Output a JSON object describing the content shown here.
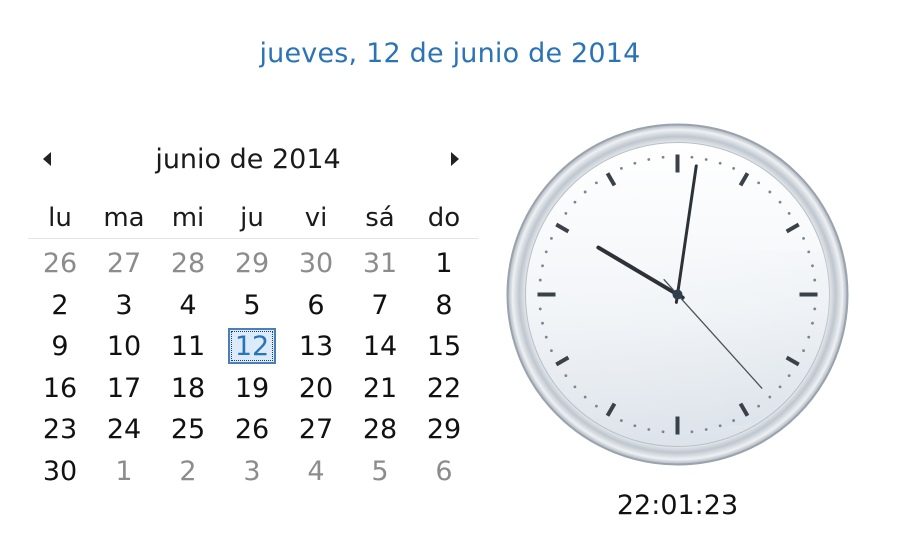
{
  "header": {
    "long_date": "jueves, 12 de junio de 2014"
  },
  "calendar": {
    "month_title": "junio de 2014",
    "nav": {
      "prev_icon": "triangle-left-icon",
      "next_icon": "triangle-right-icon"
    },
    "weekdays": [
      "lu",
      "ma",
      "mi",
      "ju",
      "vi",
      "sá",
      "do"
    ],
    "weeks": [
      [
        {
          "d": "26",
          "other": true
        },
        {
          "d": "27",
          "other": true
        },
        {
          "d": "28",
          "other": true
        },
        {
          "d": "29",
          "other": true
        },
        {
          "d": "30",
          "other": true
        },
        {
          "d": "31",
          "other": true
        },
        {
          "d": "1"
        }
      ],
      [
        {
          "d": "2"
        },
        {
          "d": "3"
        },
        {
          "d": "4"
        },
        {
          "d": "5"
        },
        {
          "d": "6"
        },
        {
          "d": "7"
        },
        {
          "d": "8"
        }
      ],
      [
        {
          "d": "9"
        },
        {
          "d": "10"
        },
        {
          "d": "11"
        },
        {
          "d": "12",
          "today": true
        },
        {
          "d": "13"
        },
        {
          "d": "14"
        },
        {
          "d": "15"
        }
      ],
      [
        {
          "d": "16"
        },
        {
          "d": "17"
        },
        {
          "d": "18"
        },
        {
          "d": "19"
        },
        {
          "d": "20"
        },
        {
          "d": "21"
        },
        {
          "d": "22"
        }
      ],
      [
        {
          "d": "23"
        },
        {
          "d": "24"
        },
        {
          "d": "25"
        },
        {
          "d": "26"
        },
        {
          "d": "27"
        },
        {
          "d": "28"
        },
        {
          "d": "29"
        }
      ],
      [
        {
          "d": "30"
        },
        {
          "d": "1",
          "other": true
        },
        {
          "d": "2",
          "other": true
        },
        {
          "d": "3",
          "other": true
        },
        {
          "d": "4",
          "other": true
        },
        {
          "d": "5",
          "other": true
        },
        {
          "d": "6",
          "other": true
        }
      ]
    ],
    "colors": {
      "accent": "#2a73b6",
      "other_month": "#8c8c8c"
    }
  },
  "clock": {
    "time_text": "22:01:23",
    "hours": 22,
    "minutes": 1,
    "seconds": 23
  }
}
